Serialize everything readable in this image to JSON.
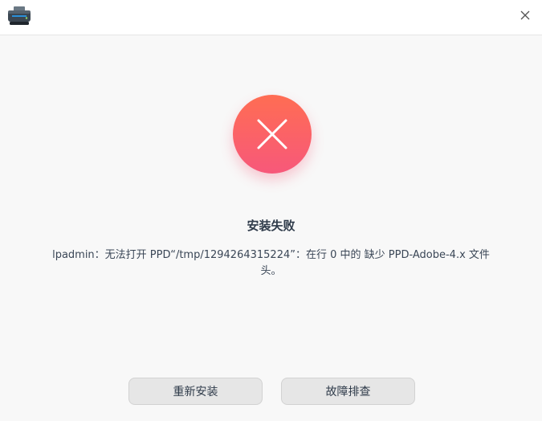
{
  "titlebar": {
    "app_icon": "printer-icon",
    "close_icon": "close-icon"
  },
  "dialog": {
    "status_icon": "error-x-icon",
    "title": "安装失败",
    "message": "lpadmin：无法打开 PPD“/tmp/1294264315224”：在行 0 中的 缺少 PPD-Adobe-4.x 文件头。",
    "buttons": {
      "reinstall_label": "重新安装",
      "troubleshoot_label": "故障排查"
    }
  },
  "colors": {
    "error_gradient_top": "#ff6d53",
    "error_gradient_bottom": "#f7587a",
    "button_bg": "#e6e6e6",
    "window_bg": "#f8f8f8"
  }
}
